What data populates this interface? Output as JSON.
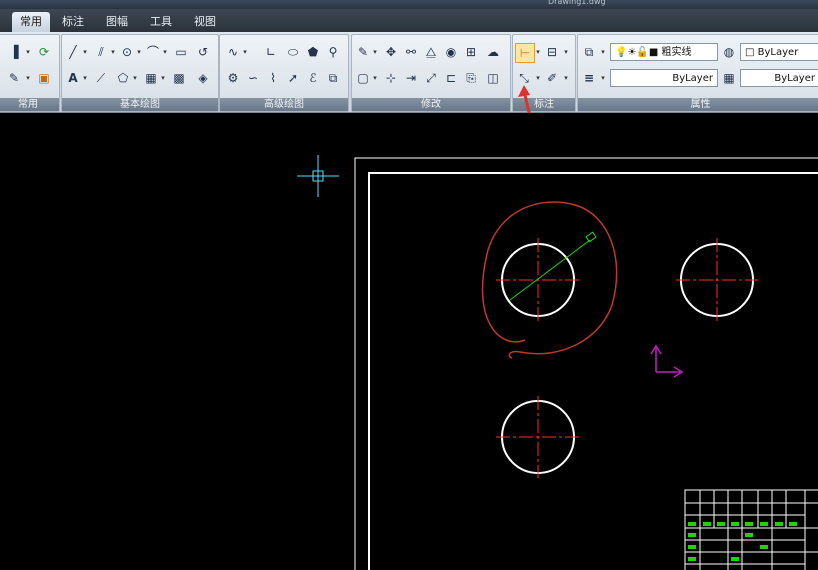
{
  "app": {
    "title_fragment": "Drawing1.dwg"
  },
  "tabs": [
    {
      "label": "常用"
    },
    {
      "label": "标注"
    },
    {
      "label": "图幅"
    },
    {
      "label": "工具"
    },
    {
      "label": "视图"
    }
  ],
  "panels": {
    "common": "常用",
    "draw": "基本绘图",
    "advanced": "高级绘图",
    "modify": "修改",
    "dimension": "标注",
    "properties": "属性"
  },
  "properties": {
    "linetype_label": "粗实线",
    "color_value": "ByLayer",
    "lineweight_value": "ByLayer",
    "linetype_value": "ByLayer"
  },
  "colors": {
    "circle_white": "#ffffff",
    "centerline_red": "#ff2d2d",
    "annotation_red": "#c0392b",
    "leader_green": "#1fd400",
    "ucs_magenta": "#c020c0",
    "cursor_cyan": "#55e0ff"
  },
  "icons": [
    "line-icon",
    "parallel-icon",
    "circle-icon",
    "arc-icon",
    "rectangle-icon",
    "spline-icon",
    "text-icon",
    "hatch-icon",
    "block-icon",
    "table-icon",
    "polygon-icon",
    "move-icon",
    "copy-icon",
    "mirror-icon",
    "rotate-icon",
    "array-icon",
    "dimension-icon",
    "layer-icon"
  ]
}
